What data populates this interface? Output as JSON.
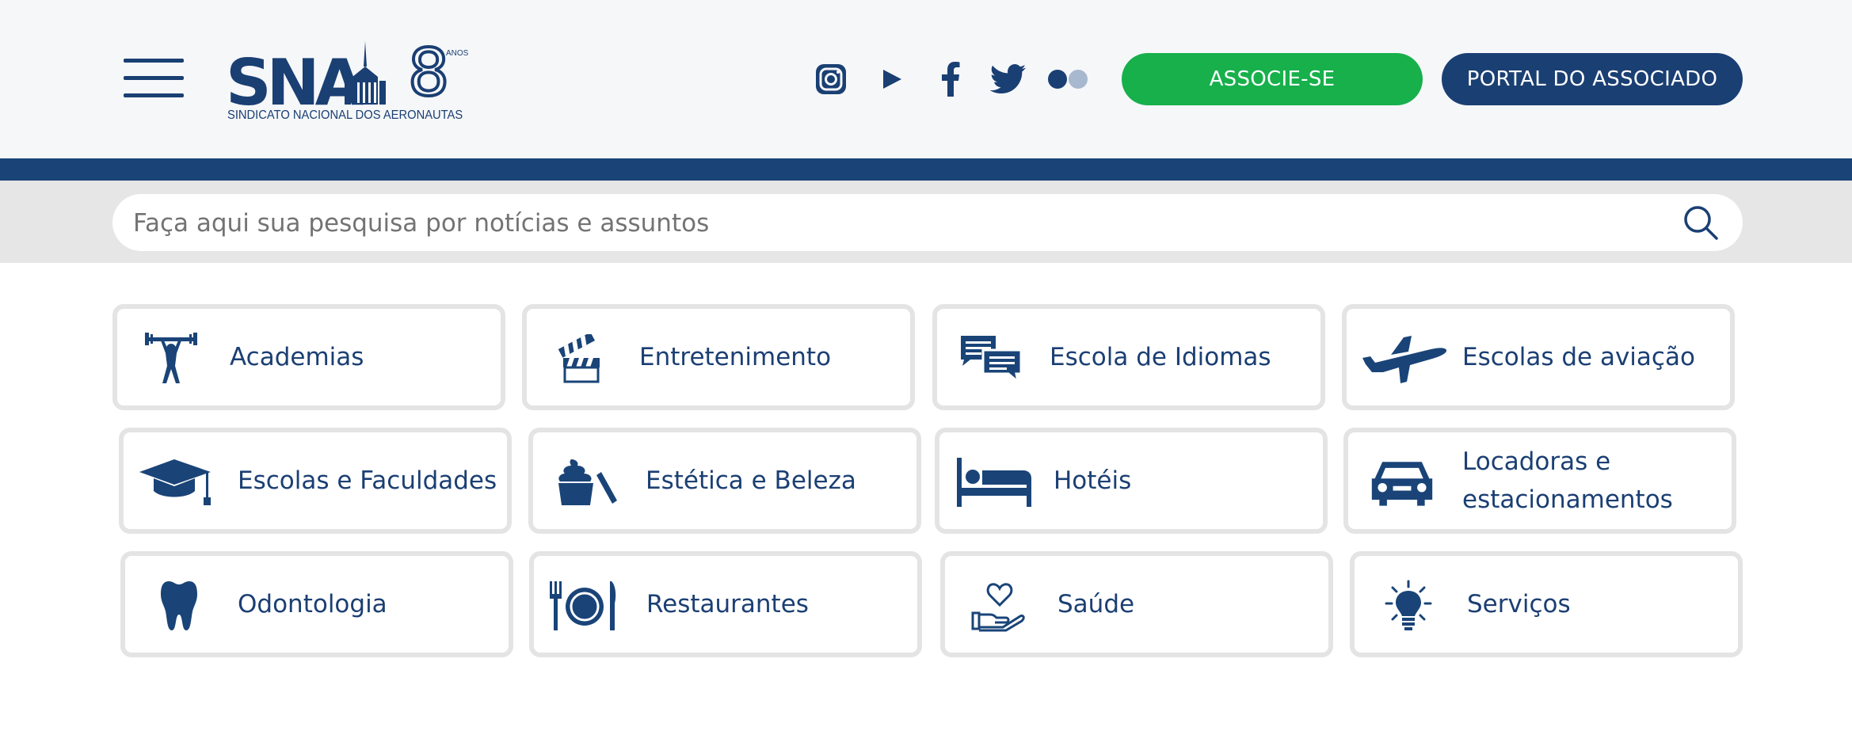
{
  "header": {
    "logo": {
      "text": "SNA",
      "anniversary": "8",
      "anos": "ANOS",
      "subtitle": "SINDICATO NACIONAL DOS AERONAUTAS"
    },
    "menu_icon": "hamburger-menu-icon",
    "social": [
      "instagram-icon",
      "youtube-icon",
      "facebook-icon",
      "twitter-icon",
      "flickr-icon"
    ],
    "associe_label": "ASSOCIE-SE",
    "portal_label": "PORTAL DO ASSOCIADO"
  },
  "search": {
    "placeholder": "Faça aqui sua pesquisa por notícias e assuntos",
    "value": ""
  },
  "categories": [
    {
      "label": "Academias",
      "icon": "weightlifter-icon"
    },
    {
      "label": "Entretenimento",
      "icon": "clapperboard-icon"
    },
    {
      "label": "Escola de Idiomas",
      "icon": "chat-bubbles-icon"
    },
    {
      "label": "Escolas de aviação",
      "icon": "airplane-icon"
    },
    {
      "label": "Escolas e Faculdades",
      "icon": "graduation-cap-icon"
    },
    {
      "label": "Estética e Beleza",
      "icon": "cosmetics-icon"
    },
    {
      "label": "Hotéis",
      "icon": "bed-icon"
    },
    {
      "label": "Locadoras e estacionamentos",
      "icon": "car-icon"
    },
    {
      "label": "Odontologia",
      "icon": "tooth-icon"
    },
    {
      "label": "Restaurantes",
      "icon": "plate-cutlery-icon"
    },
    {
      "label": "Saúde",
      "icon": "heart-hand-icon"
    },
    {
      "label": "Serviços",
      "icon": "lightbulb-icon"
    }
  ],
  "colors": {
    "primary": "#1a3f73",
    "accent_green": "#17b04b",
    "header_bg": "#f6f7f9",
    "search_band": "#e6e6e6",
    "card_border": "#e4e4e4"
  }
}
